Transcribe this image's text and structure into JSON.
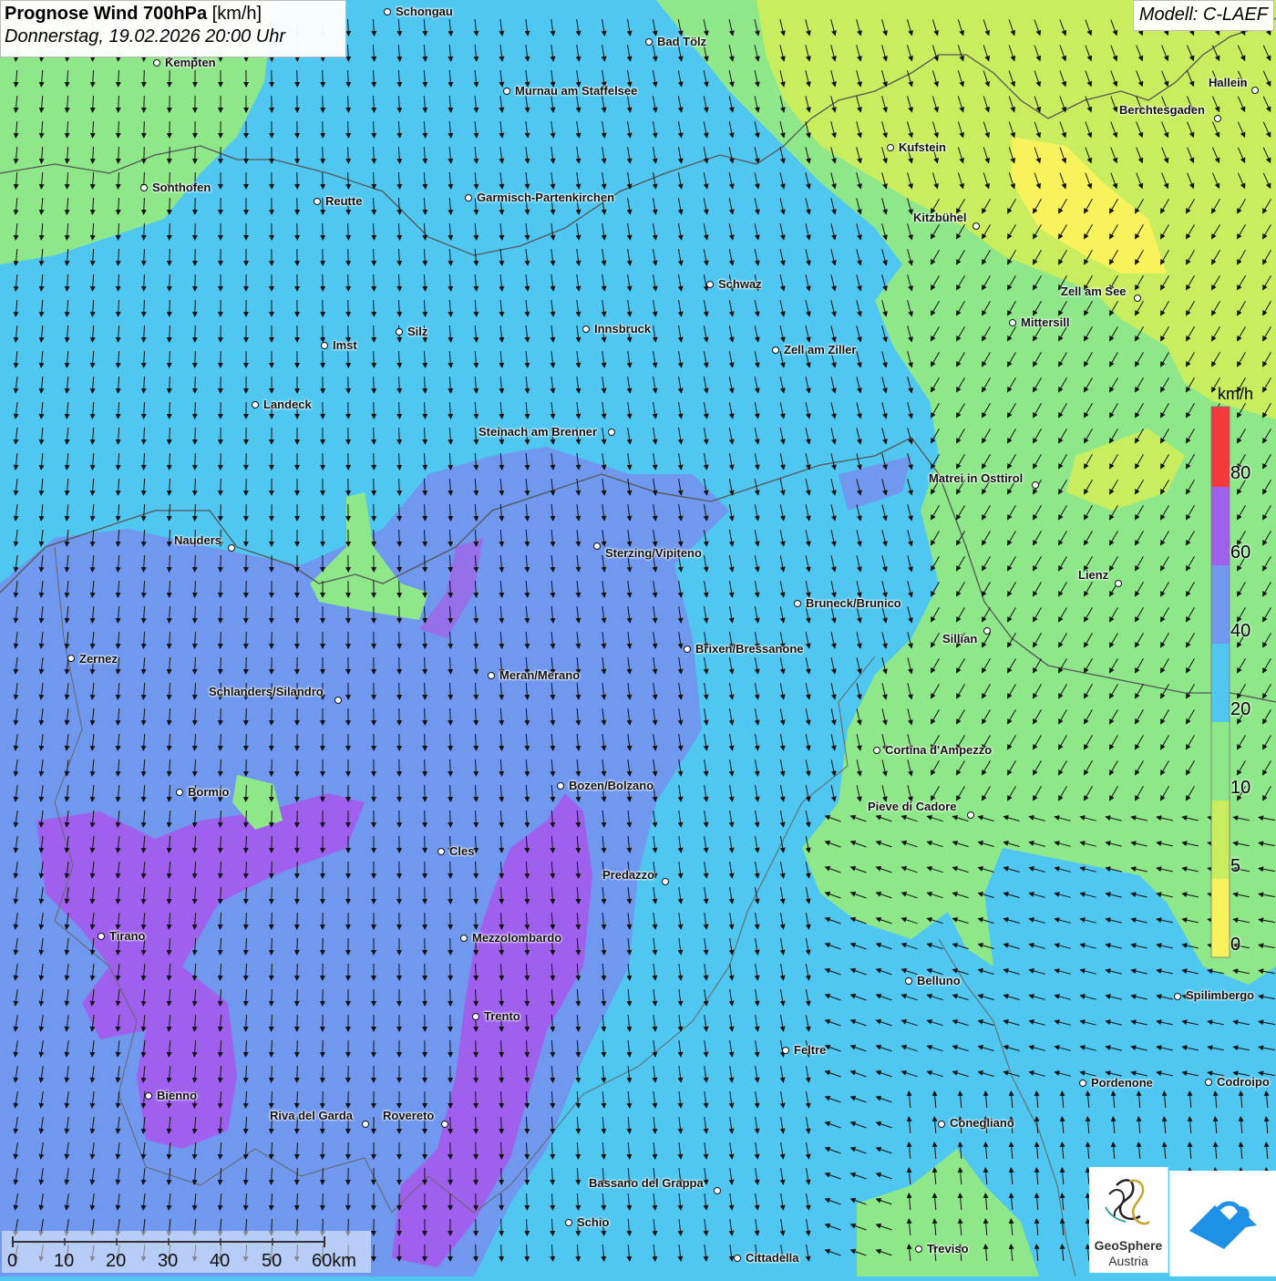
{
  "header": {
    "title_bold": "Prognose Wind 700hPa",
    "title_unit": " [km/h]",
    "subtitle": "Donnerstag, 19.02.2026 20:00 Uhr",
    "model": "Modell: C-LAEF"
  },
  "colors": {
    "wind_0": "#f8f25c",
    "wind_5": "#c8ee60",
    "wind_10": "#8ee88a",
    "wind_20": "#4fc7f0",
    "wind_40": "#6f98ee",
    "wind_60": "#a060ee",
    "wind_80": "#f23a3a",
    "arrows": "#111111",
    "borders": "#555555"
  },
  "legend": {
    "unit": "km/h",
    "labels": [
      "80",
      "60",
      "40",
      "20",
      "10",
      "5",
      "0"
    ]
  },
  "scale_bar": {
    "labels": [
      "0",
      "10",
      "20",
      "30",
      "40",
      "50",
      "60km"
    ]
  },
  "logos": {
    "geosphere_line1": "GeoSphere",
    "geosphere_line2": "Austria"
  },
  "cities": [
    {
      "name": "Schongau"
    },
    {
      "name": "Bad Tölz"
    },
    {
      "name": "Kempten"
    },
    {
      "name": "Murnau am Staffelsee"
    },
    {
      "name": "Hallein"
    },
    {
      "name": "Berchtesgaden"
    },
    {
      "name": "Kufstein"
    },
    {
      "name": "Sonthofen"
    },
    {
      "name": "Reutte"
    },
    {
      "name": "Garmisch-Partenkirchen"
    },
    {
      "name": "Kitzbühel"
    },
    {
      "name": "Schwaz"
    },
    {
      "name": "Zell am See"
    },
    {
      "name": "Mittersill"
    },
    {
      "name": "Innsbruck"
    },
    {
      "name": "Silz"
    },
    {
      "name": "Imst"
    },
    {
      "name": "Zell am Ziller"
    },
    {
      "name": "Landeck"
    },
    {
      "name": "Steinach am Brenner"
    },
    {
      "name": "Matrei in Osttirol"
    },
    {
      "name": "Nauders"
    },
    {
      "name": "Sterzing/Vipiteno"
    },
    {
      "name": "Lienz"
    },
    {
      "name": "Bruneck/Brunico"
    },
    {
      "name": "Sillian"
    },
    {
      "name": "Brixen/Bressanone"
    },
    {
      "name": "Zernez"
    },
    {
      "name": "Meran/Merano"
    },
    {
      "name": "Schlanders/Silandro"
    },
    {
      "name": "Cortina d'Ampezzo"
    },
    {
      "name": "Bozen/Bolzano"
    },
    {
      "name": "Bormio"
    },
    {
      "name": "Pieve di Cadore"
    },
    {
      "name": "Cles"
    },
    {
      "name": "Predazzo"
    },
    {
      "name": "Tirano"
    },
    {
      "name": "Mezzolombardo"
    },
    {
      "name": "Belluno"
    },
    {
      "name": "Spilimbergo"
    },
    {
      "name": "Trento"
    },
    {
      "name": "Feltre"
    },
    {
      "name": "Pordenone"
    },
    {
      "name": "Codroipo"
    },
    {
      "name": "Bienno"
    },
    {
      "name": "Riva del Garda"
    },
    {
      "name": "Rovereto"
    },
    {
      "name": "Conegliano"
    },
    {
      "name": "Bassano del Grappa"
    },
    {
      "name": "Schio"
    },
    {
      "name": "Treviso"
    },
    {
      "name": "Cittadella"
    }
  ]
}
